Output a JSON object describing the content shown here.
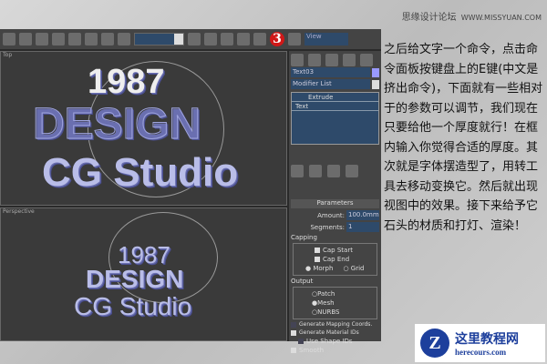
{
  "watermark": {
    "cn": "思缘设计论坛",
    "url": "WWW.MISSYUAN.COM"
  },
  "toolbar": {
    "step_badge": "3",
    "view_select": "View"
  },
  "viewports": {
    "top_label": "Top",
    "persp_label": "Perspective",
    "scene_lines": [
      "1987",
      "DESIGN",
      "CG Studio"
    ]
  },
  "panel": {
    "object_name": "Text03",
    "modifier_list": "Modifier List",
    "stack": [
      "Extrude",
      "Text"
    ],
    "rollout": "Parameters",
    "amount_label": "Amount:",
    "amount": "100.0mm",
    "segments_label": "Segments:",
    "segments": "1",
    "capping": "Capping",
    "cap_start": "Cap Start",
    "cap_end": "Cap End",
    "morph": "Morph",
    "grid": "Grid",
    "output": "Output",
    "patch": "Patch",
    "mesh": "Mesh",
    "nurbs": "NURBS",
    "gen_mapping": "Generate Mapping Coords.",
    "gen_matids": "Generate Material IDs",
    "use_shape_ids": "Use Shape IDs",
    "smooth": "Smooth"
  },
  "instructions": "之后给文字一个命令，点击命令面板按键盘上的E键(中文是挤出命令)，下面就有一些相对于的参数可以调节，我们现在只要给他一个厚度就行！在框内输入你觉得合适的厚度。其次就是字体摆造型了，用转工具去移动变换它。然后就出现视图中的效果。接下来给予它石头的材质和打灯、渲染！",
  "logo": {
    "cn": "这里教程网",
    "url": "herecours.com"
  }
}
